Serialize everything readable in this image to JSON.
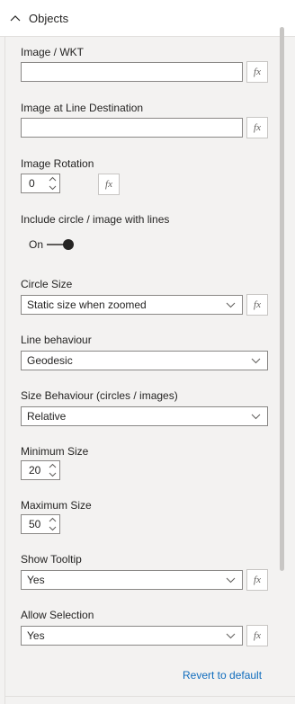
{
  "section": {
    "title": "Objects"
  },
  "image_wkt": {
    "label": "Image / WKT",
    "value": "",
    "fx": "fx"
  },
  "image_line_dest": {
    "label": "Image at Line Destination",
    "value": "",
    "fx": "fx"
  },
  "image_rotation": {
    "label": "Image Rotation",
    "value": "0",
    "fx": "fx"
  },
  "include_circle": {
    "label": "Include circle / image with lines",
    "state": "On"
  },
  "circle_size": {
    "label": "Circle Size",
    "value": "Static size when zoomed",
    "fx": "fx"
  },
  "line_behaviour": {
    "label": "Line behaviour",
    "value": "Geodesic"
  },
  "size_behaviour": {
    "label": "Size Behaviour (circles / images)",
    "value": "Relative"
  },
  "minimum_size": {
    "label": "Minimum Size",
    "value": "20"
  },
  "maximum_size": {
    "label": "Maximum Size",
    "value": "50"
  },
  "show_tooltip": {
    "label": "Show Tooltip",
    "value": "Yes",
    "fx": "fx"
  },
  "allow_selection": {
    "label": "Allow Selection",
    "value": "Yes",
    "fx": "fx"
  },
  "revert": {
    "label": "Revert to default"
  },
  "colors": {
    "accent": "#0f6cbd",
    "border": "#8a8886",
    "panel": "#f3f2f1"
  },
  "icons": {
    "section": "chevron-up-icon",
    "dropdown": "chevron-down-icon",
    "spinner": "spinner-arrows-icon"
  }
}
